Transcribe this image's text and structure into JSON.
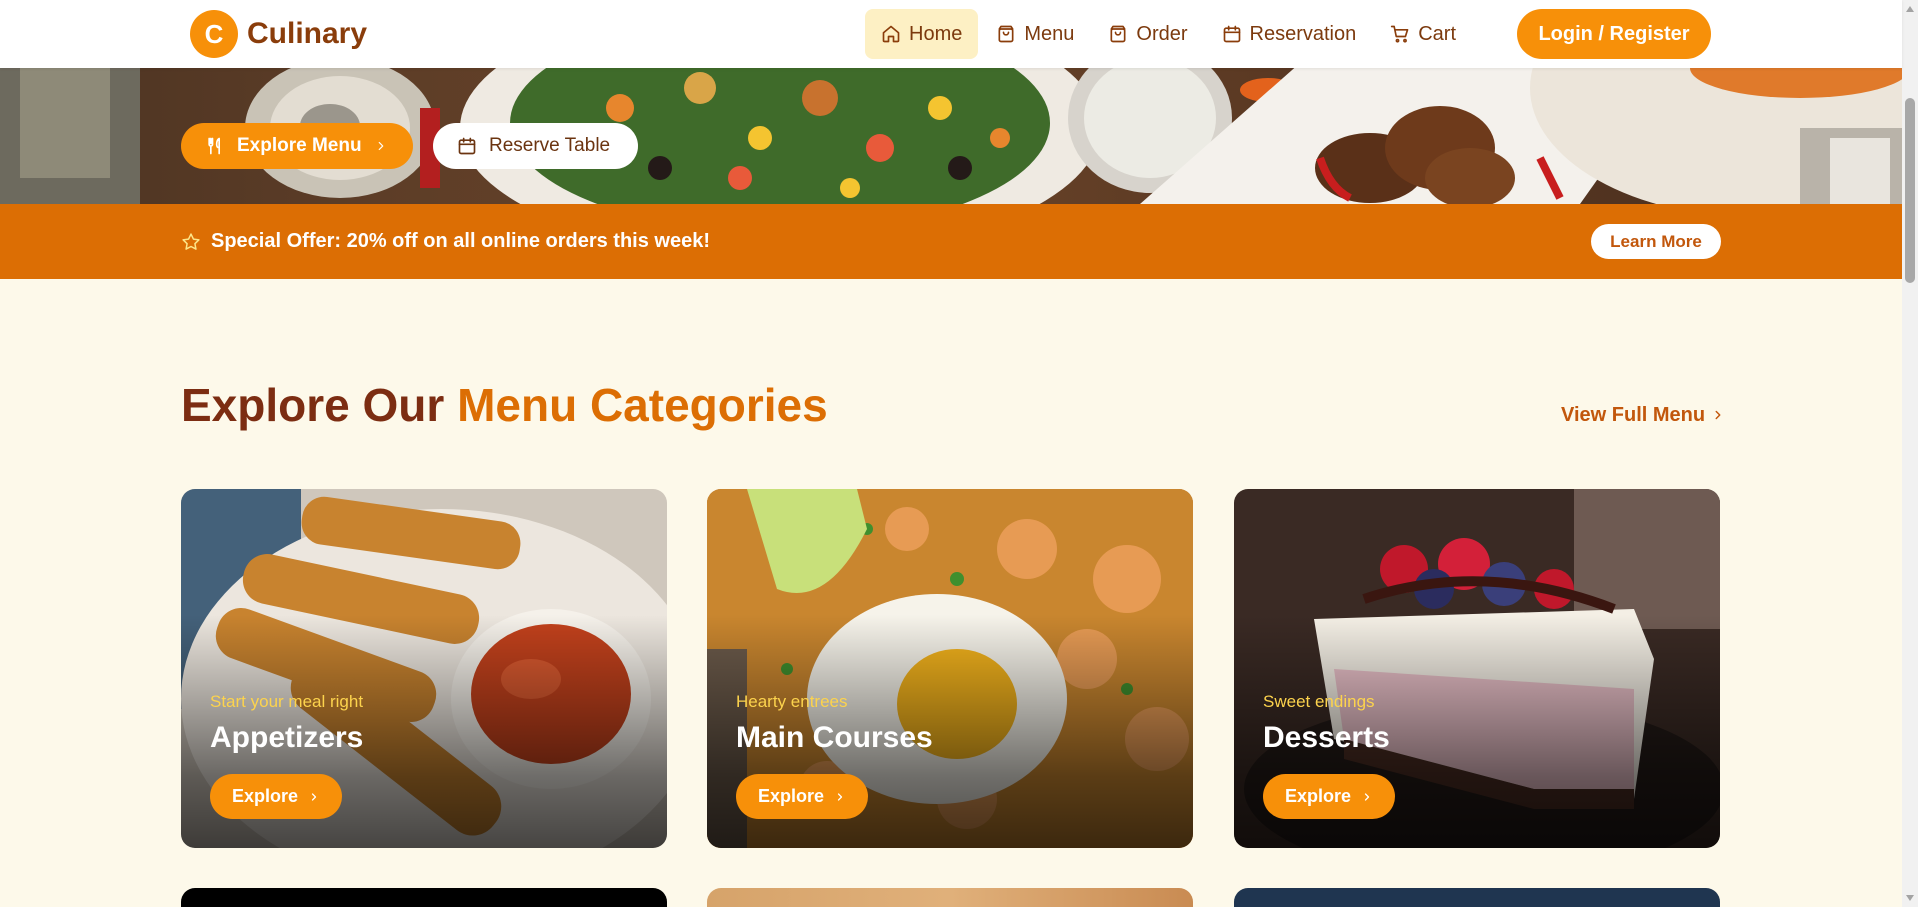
{
  "brand": {
    "logo_letter": "C",
    "name": "Culinary"
  },
  "nav": {
    "items": [
      {
        "label": "Home",
        "icon": "home-icon",
        "active": true
      },
      {
        "label": "Menu",
        "icon": "bag-icon",
        "active": false
      },
      {
        "label": "Order",
        "icon": "bag-icon",
        "active": false
      },
      {
        "label": "Reservation",
        "icon": "calendar-icon",
        "active": false
      },
      {
        "label": "Cart",
        "icon": "cart-icon",
        "active": false
      }
    ],
    "login_label": "Login / Register"
  },
  "hero": {
    "explore_menu_label": "Explore Menu",
    "reserve_table_label": "Reserve Table"
  },
  "offer": {
    "text": "Special Offer: 20% off on all online orders this week!",
    "learn_more_label": "Learn More"
  },
  "categories": {
    "title_part1": "Explore Our ",
    "title_part2": "Menu Categories",
    "view_full_label": "View Full Menu",
    "cards": [
      {
        "subtitle": "Start your meal right",
        "title": "Appetizers",
        "button": "Explore"
      },
      {
        "subtitle": "Hearty entrees",
        "title": "Main Courses",
        "button": "Explore"
      },
      {
        "subtitle": "Sweet endings",
        "title": "Desserts",
        "button": "Explore"
      }
    ]
  },
  "colors": {
    "primary": "#f79009",
    "offer_banner": "#dc6e04",
    "heading": "#7c2d12",
    "accent": "#dc6e04",
    "background": "#fdf9ea",
    "nav_active_bg": "#fdf0c4"
  }
}
